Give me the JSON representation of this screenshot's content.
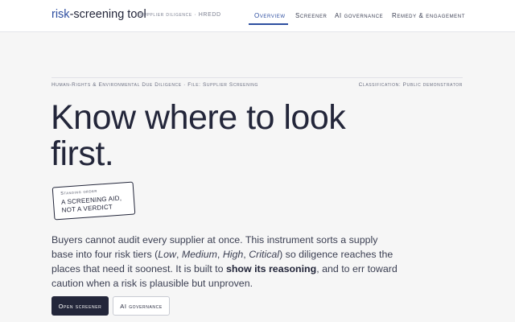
{
  "header": {
    "brand_accent": "risk",
    "brand_rest": "-screening tool",
    "brand_subtitle": "Supplier diligence · HREDD",
    "nav": [
      {
        "label": "Overview",
        "active": true
      },
      {
        "label": "Screener",
        "active": false
      },
      {
        "label": "AI governance",
        "active": false
      },
      {
        "label": "Remedy & engagement",
        "active": false
      }
    ]
  },
  "meta": {
    "left": "Human-Rights & Environmental Due Diligence · File: Supplier Screening",
    "right": "Classification: Public demonstrator"
  },
  "hero": {
    "headline": "Know where to look first."
  },
  "stamp": {
    "label": "Standing order",
    "line1": "A SCREENING AID,",
    "line2": "NOT A VERDICT"
  },
  "intro": {
    "part1": "Buyers cannot audit every supplier at once. This instrument sorts a supply base into four risk tiers (",
    "tier1": "Low",
    "sep1": ", ",
    "tier2": "Medium",
    "sep2": ", ",
    "tier3": "High",
    "sep3": ", ",
    "tier4": "Critical",
    "part2": ") so diligence reaches the places that need it soonest. It is built to ",
    "emphasis": "show its reasoning",
    "part3": ", and to err toward caution when a risk is plausible but unproven."
  },
  "actions": {
    "primary": "Open screener",
    "secondary": "AI governance"
  },
  "colors": {
    "accent": "#2d4ea0",
    "ink": "#23263a",
    "background": "#f6f6f6"
  }
}
